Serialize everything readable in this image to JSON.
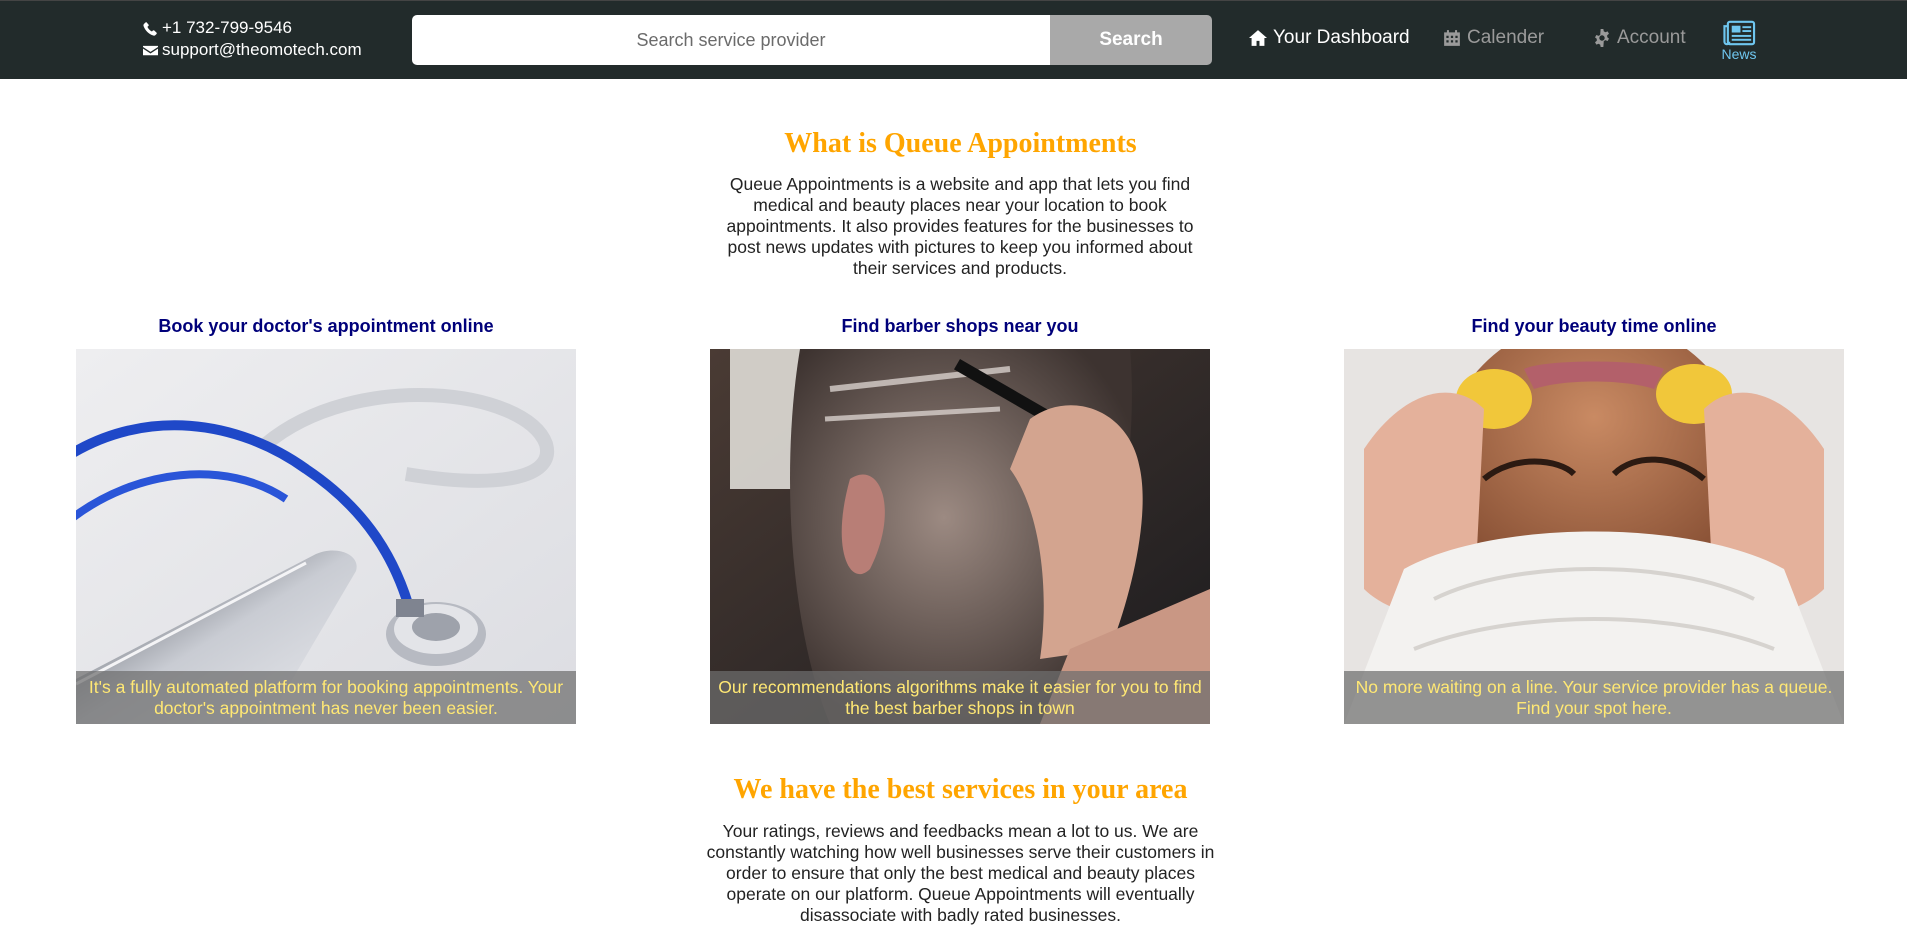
{
  "header": {
    "phone": "+1 732-799-9546",
    "email": "support@theomotech.com",
    "search": {
      "placeholder": "Search service provider",
      "button_label": "Search"
    },
    "nav": {
      "dashboard": "Your Dashboard",
      "calendar": "Calender",
      "account": "Account",
      "news": "News"
    }
  },
  "about": {
    "title": "What is Queue Appointments",
    "text": "Queue Appointments is a website and app that lets you find medical and beauty places near your location to book appointments. It also provides features for the businesses to post news updates with pictures to keep you informed about their services and products."
  },
  "cards": [
    {
      "title": "Book your doctor's appointment online",
      "caption": "It's a fully automated platform for booking appointments. Your doctor's appointment has never been easier."
    },
    {
      "title": "Find barber shops near you",
      "caption": "Our recommendations algorithms make it easier for you to find the best barber shops in town"
    },
    {
      "title": "Find your beauty time online",
      "caption": "No more waiting on a line. Your service provider has a queue. Find your spot here."
    }
  ],
  "services": {
    "title": "We have the best services in your area",
    "text": "Your ratings, reviews and feedbacks mean a lot to us. We are constantly watching how well businesses serve their customers in order to ensure that only the best medical and beauty places operate on our platform. Queue Appointments will eventually disassociate with badly rated businesses."
  },
  "colors": {
    "topbar": "#222b2b",
    "heading": "#ffa500",
    "card_title": "#00007a",
    "caption_text": "#ffe874",
    "news_accent": "#6fc6ef"
  },
  "icons": [
    "phone-icon",
    "envelope-icon",
    "home-icon",
    "calendar-icon",
    "gear-icon",
    "newspaper-icon"
  ]
}
